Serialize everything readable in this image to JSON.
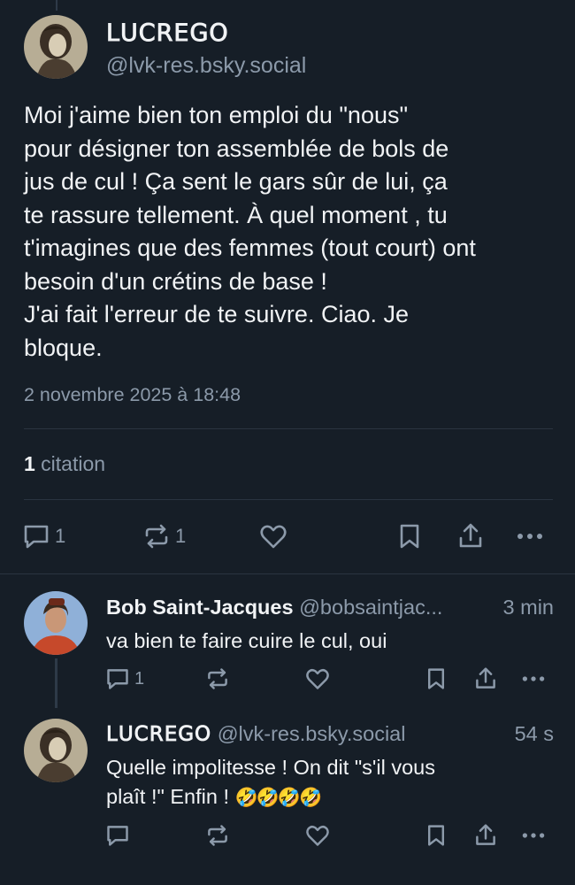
{
  "main_post": {
    "author_name": "ꓡꓴꓚꓣꓰꓖꓳ",
    "author_handle": "@lvk-res.bsky.social",
    "text": "Moi j'aime bien  ton emploi du \"nous\"\npour désigner ton assemblée de bols de\njus de cul ! Ça sent le gars sûr de lui, ça\nte rassure tellement.  À quel moment , tu\nt'imagines que des femmes (tout court) ont\nbesoin d'un crétins de base !\nJ'ai fait l'erreur de te suivre. Ciao.  Je\nbloque.",
    "date": "2 novembre 2025 à 18:48",
    "quote_count": "1",
    "quote_label": " citation",
    "reply_count": "1",
    "repost_count": "1",
    "icons": [
      "reply-icon",
      "repost-icon",
      "like-icon",
      "bookmark-icon",
      "share-icon",
      "more-icon"
    ]
  },
  "replies": [
    {
      "author_name": "Bob Saint-Jacques",
      "author_handle": "@bobsaintjac...",
      "time": "3 min",
      "text": "va bien te faire cuire le cul, oui",
      "reply_count": "1"
    },
    {
      "author_name": "ꓡꓴꓚꓣꓰꓖꓳ",
      "author_handle": "@lvk-res.bsky.social",
      "time": "54 s",
      "text_line1": "Quelle impolitesse ! On dit \"s'il vous",
      "text_line2": "plaît !\" Enfin ! ",
      "emojis": "🤣🤣🤣🤣"
    }
  ],
  "colors": {
    "background": "#161e27",
    "text": "#f1f3f5",
    "muted": "#8c9aaa",
    "divider": "#2a3440"
  }
}
